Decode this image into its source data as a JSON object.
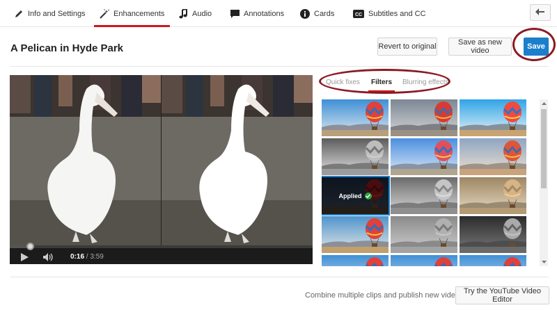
{
  "tabs": [
    {
      "label": "Info and Settings",
      "icon": "pencil-icon"
    },
    {
      "label": "Enhancements",
      "icon": "magic-wand-icon",
      "active": true
    },
    {
      "label": "Audio",
      "icon": "music-note-icon"
    },
    {
      "label": "Annotations",
      "icon": "speech-bubble-icon"
    },
    {
      "label": "Cards",
      "icon": "info-circle-icon"
    },
    {
      "label": "Subtitles and CC",
      "icon": "cc-icon"
    }
  ],
  "header": {
    "title": "A Pelican in Hyde Park",
    "revert_label": "Revert to original",
    "save_as_label": "Save as new video",
    "save_label": "Save"
  },
  "player": {
    "current_time": "0:16",
    "separator": " / ",
    "duration": "3:59",
    "progress": 0.067
  },
  "panel": {
    "subtabs": [
      {
        "label": "Quick fixes"
      },
      {
        "label": "Filters",
        "active": true
      },
      {
        "label": "Blurring effects"
      }
    ],
    "applied_label": "Applied",
    "filters": [
      {
        "style": "natural"
      },
      {
        "style": "gray-sky"
      },
      {
        "style": "vivid"
      },
      {
        "style": "bw"
      },
      {
        "style": "cool"
      },
      {
        "style": "warm"
      },
      {
        "style": "dark-red",
        "applied": true
      },
      {
        "style": "bw-soft"
      },
      {
        "style": "sepia"
      },
      {
        "style": "natural-2"
      },
      {
        "style": "bw-flat"
      },
      {
        "style": "bw-dark"
      },
      {
        "style": "natural-3"
      },
      {
        "style": "natural-4"
      },
      {
        "style": "natural-5"
      }
    ]
  },
  "footer": {
    "text": "Combine multiple clips and publish new videos.",
    "button_label": "Try the YouTube Video Editor"
  },
  "colors": {
    "accent": "#cc181e",
    "save_blue": "#1b7fcc",
    "highlight_ring": "#8b1a23"
  }
}
